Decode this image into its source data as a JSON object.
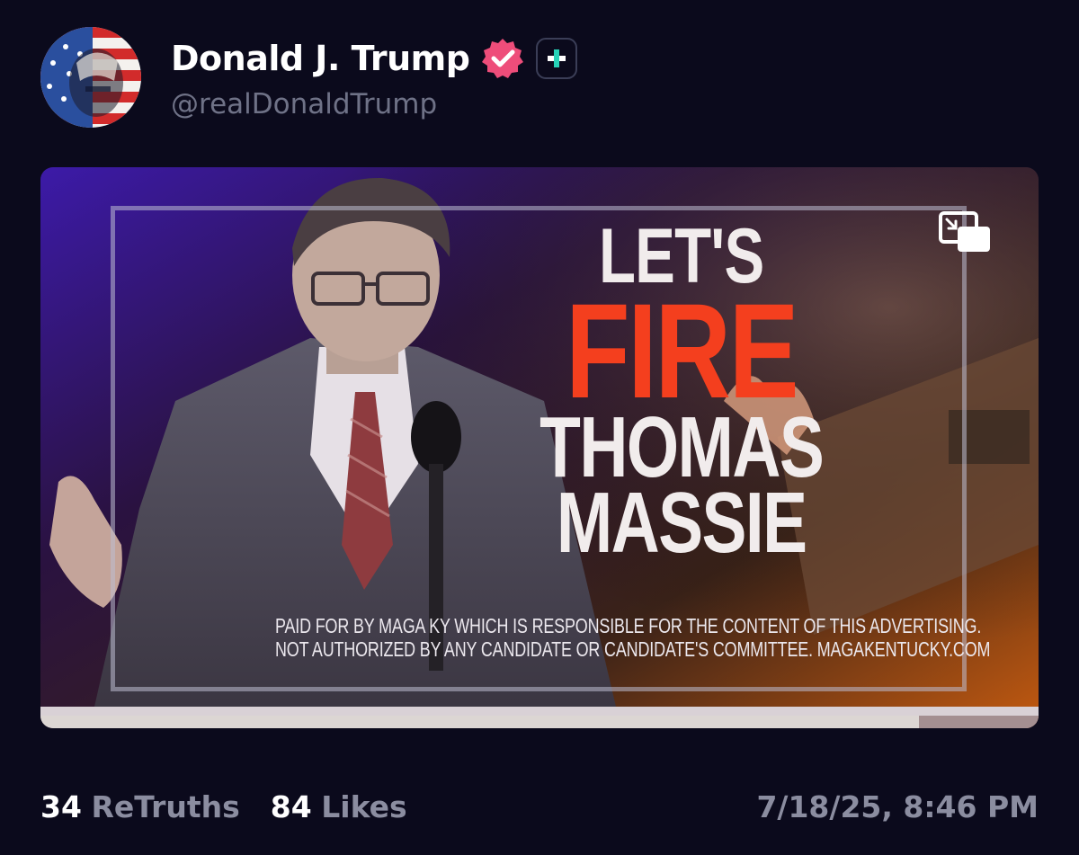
{
  "author": {
    "display_name": "Donald J. Trump",
    "handle": "@realDonaldTrump",
    "avatar_icon": "avatar-american-flag-portrait",
    "verified_color": "#ee4d7a",
    "plus_color": "#27d3b8"
  },
  "media": {
    "type": "video",
    "headline": {
      "line1": "LET'S",
      "line2": "FIRE",
      "line3": "THOMAS",
      "line4": "MASSIE"
    },
    "disclaimer": {
      "line1": "PAID FOR BY MAGA KY WHICH IS RESPONSIBLE FOR THE CONTENT OF THIS ADVERTISING.",
      "line2": "NOT AUTHORIZED BY ANY CANDIDATE OR CANDIDATE'S COMMITTEE. MAGAKENTUCKY.COM"
    },
    "pip_icon": "picture-in-picture-icon",
    "progress": 0.88
  },
  "stats": {
    "retruths_count": "34",
    "retruths_label": "ReTruths",
    "likes_count": "84",
    "likes_label": "Likes"
  },
  "timestamp": "7/18/25, 8:46 PM"
}
